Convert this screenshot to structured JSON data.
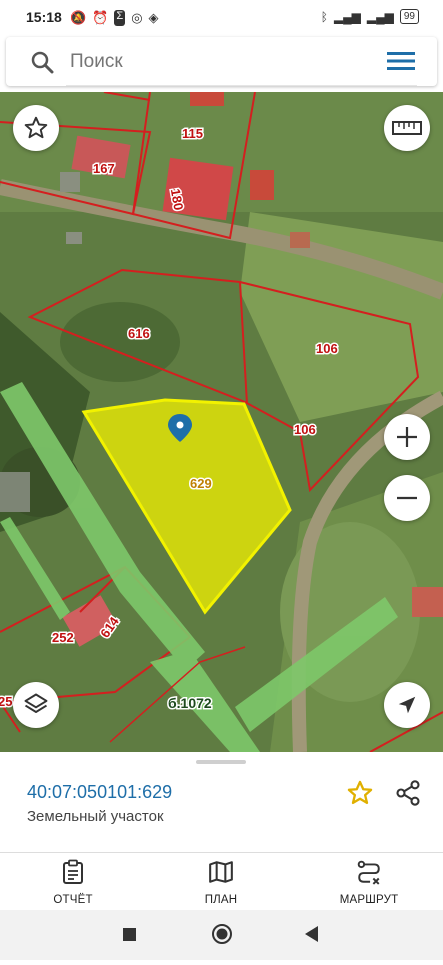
{
  "status_bar": {
    "time": "15:18",
    "battery": "99",
    "left_icons": [
      "alarm-off-icon",
      "alarm-icon",
      "sigma-icon",
      "whatsapp-icon",
      "app-icon"
    ],
    "right_icons": [
      "bluetooth-icon",
      "signal-icon",
      "signal-icon-2",
      "battery-icon"
    ]
  },
  "search": {
    "placeholder": "Поиск"
  },
  "map": {
    "parcel_labels": {
      "p115": "115",
      "p167": "167",
      "p180": "180",
      "p616": "616",
      "p106a": "106",
      "p106b": "106",
      "p629": "629",
      "p614": "614",
      "p252": "252",
      "p25": "25",
      "road": "б.1072"
    },
    "highlight_color": "#f2f200",
    "boundary_color": "#d41f1f",
    "road_color": "#7ec86a"
  },
  "parcel": {
    "cadastral_number": "40:07:050101:629",
    "type": "Земельный участок",
    "favorite_color": "#e0b000"
  },
  "bottom_nav": {
    "report": "ОТЧЁТ",
    "plan": "ПЛАН",
    "route": "МАРШРУТ"
  }
}
